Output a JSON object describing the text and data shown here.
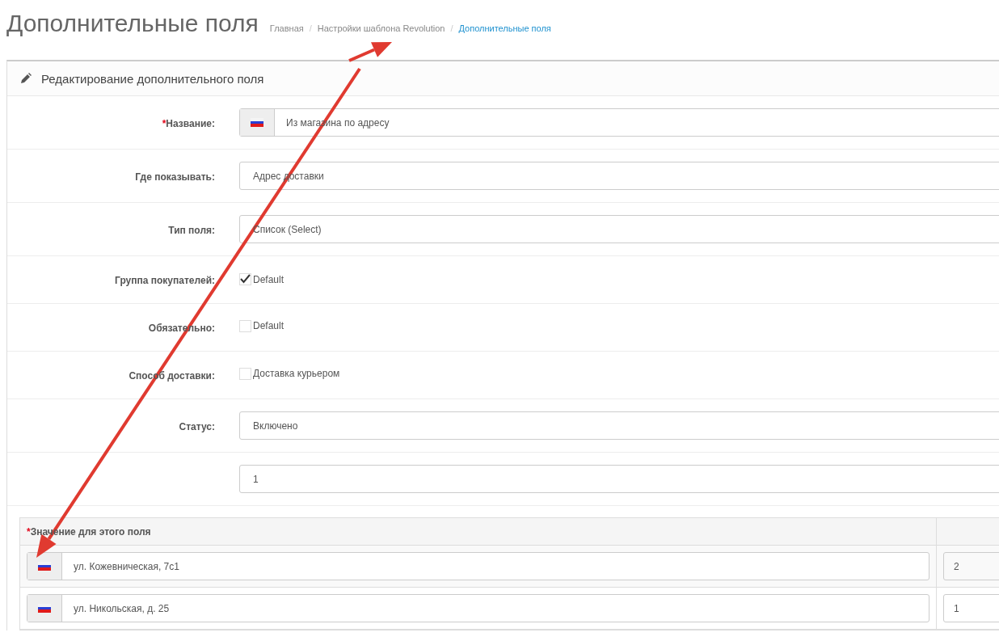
{
  "page_title": "Дополнительные поля",
  "breadcrumbs": [
    {
      "label": "Главная",
      "current": false
    },
    {
      "separator": "/",
      "label": "Настройки шаблона Revolution",
      "current": false
    },
    {
      "separator": "/",
      "label": "Дополнительные поля",
      "current": true
    }
  ],
  "panel": {
    "title": "Редактирование дополнительного поля"
  },
  "form_rows": [
    {
      "kind": "lang-input",
      "label": "Название:",
      "required_mark": "*",
      "value": "Из магазина по адресу"
    },
    {
      "kind": "select",
      "label": "Где показывать:",
      "value": "Адрес доставки"
    },
    {
      "kind": "select",
      "label": "Тип поля:",
      "value": "Список (Select)"
    },
    {
      "kind": "checkbox",
      "label": "Группа покупателей:",
      "option": "Default",
      "checked": true
    },
    {
      "kind": "checkbox",
      "label": "Обязательно:",
      "option": "Default",
      "checked": false
    },
    {
      "kind": "checkbox",
      "label": "Способ доставки:",
      "option": "Доставка курьером",
      "checked": false
    },
    {
      "kind": "select",
      "label": "Статус:",
      "value": "Включено"
    },
    {
      "kind": "input",
      "value": "1"
    }
  ],
  "values_table": {
    "header": "Значение для этого поля",
    "required_mark": "*",
    "rows": [
      {
        "value": "ул. Кожевническая, 7с1",
        "sort": "2"
      },
      {
        "value": "ул. Никольская, д. 25",
        "sort": "1"
      }
    ]
  }
}
